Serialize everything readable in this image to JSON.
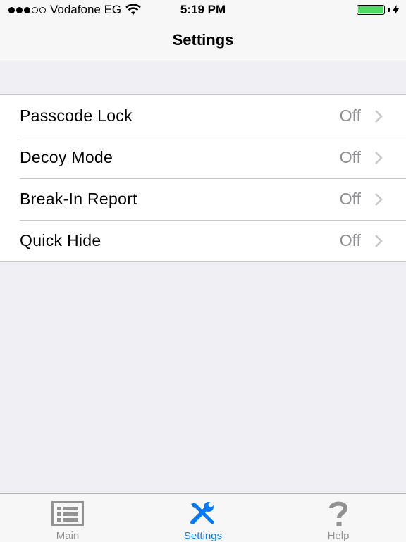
{
  "status_bar": {
    "signal_bars_on": 3,
    "signal_bars_total": 5,
    "carrier": "Vodafone EG",
    "wifi_icon": "wifi-icon",
    "time": "5:19 PM",
    "battery_level": 1.0,
    "charging_icon": "bolt-icon"
  },
  "nav": {
    "title": "Settings"
  },
  "settings": {
    "rows": [
      {
        "label": "Passcode Lock",
        "value": "Off"
      },
      {
        "label": "Decoy Mode",
        "value": "Off"
      },
      {
        "label": "Break-In Report",
        "value": "Off"
      },
      {
        "label": "Quick Hide",
        "value": "Off"
      }
    ]
  },
  "tabs": [
    {
      "label": "Main",
      "icon": "list-icon",
      "active": false
    },
    {
      "label": "Settings",
      "icon": "tools-icon",
      "active": true
    },
    {
      "label": "Help",
      "icon": "question-icon",
      "active": false
    }
  ],
  "colors": {
    "accent": "#007aff",
    "battery": "#4cd964",
    "secondary_text": "#8e8e93",
    "background": "#efeff4"
  }
}
